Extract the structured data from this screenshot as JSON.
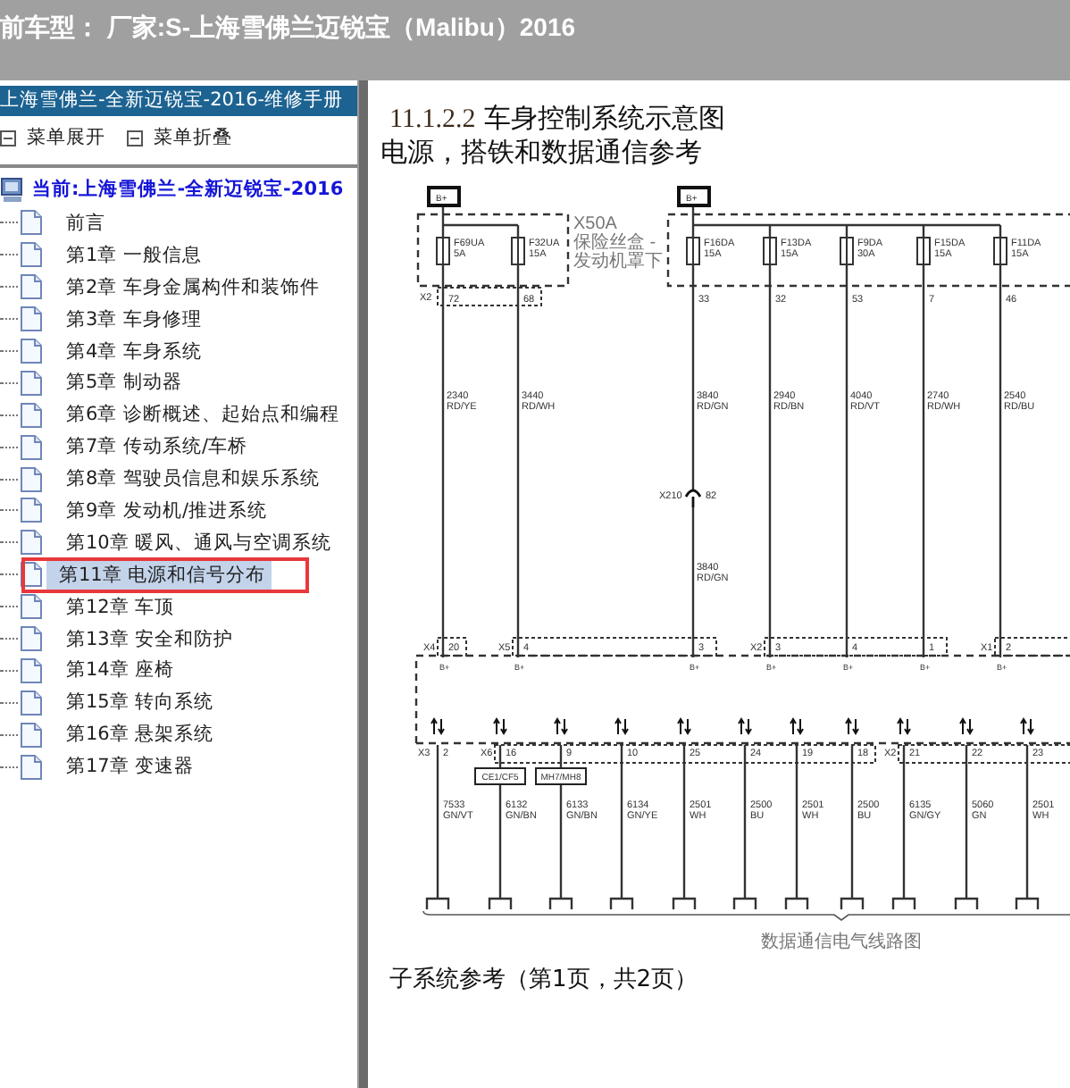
{
  "title_bar": {
    "text": "前车型：  厂家:S-上海雪佛兰迈锐宝（Malibu）2016"
  },
  "sidebar": {
    "header": "上海雪佛兰-全新迈锐宝-2016-维修手册",
    "toolbar": [
      {
        "label": "菜单展开"
      },
      {
        "label": "菜单折叠"
      }
    ],
    "tree": {
      "label": "当前:上海雪佛兰-全新迈锐宝-2016",
      "children": [
        {
          "label": "前言",
          "selected": false
        },
        {
          "label": "第1章 一般信息",
          "selected": false
        },
        {
          "label": "第2章 车身金属构件和装饰件",
          "selected": false
        },
        {
          "label": "第3章 车身修理",
          "selected": false
        },
        {
          "label": "第4章 车身系统",
          "selected": false
        },
        {
          "label": "第5章 制动器",
          "selected": false
        },
        {
          "label": "第6章 诊断概述、起始点和编程",
          "selected": false
        },
        {
          "label": "第7章 传动系统/车桥",
          "selected": false
        },
        {
          "label": "第8章 驾驶员信息和娱乐系统",
          "selected": false
        },
        {
          "label": "第9章 发动机/推进系统",
          "selected": false
        },
        {
          "label": "第10章 暖风、通风与空调系统",
          "selected": false
        },
        {
          "label": "第11章 电源和信号分布",
          "selected": true
        },
        {
          "label": "第12章 车顶",
          "selected": false
        },
        {
          "label": "第13章 安全和防护",
          "selected": false
        },
        {
          "label": "第14章 座椅",
          "selected": false
        },
        {
          "label": "第15章 转向系统",
          "selected": false
        },
        {
          "label": "第16章 悬架系统",
          "selected": false
        },
        {
          "label": "第17章 变速器",
          "selected": false
        }
      ]
    }
  },
  "document": {
    "heading_number": "11.1.2.2",
    "heading": "车身控制系统示意图",
    "subtitle": "电源，搭铁和数据通信参考",
    "diagram": {
      "fuse_groups": [
        {
          "source": "B+",
          "box_label": [
            "X50A",
            "保险丝盒 -",
            "发动机罩下"
          ],
          "connector": "X2",
          "fuses": [
            {
              "fuse": "F69UA",
              "rating": "5A",
              "pin": "72",
              "wire": "2340",
              "color_code": "RD/YE",
              "bottom_connector": "X4",
              "bottom_pin": "20",
              "terminal": "B+"
            },
            {
              "fuse": "F32UA",
              "rating": "15A",
              "pin": "68",
              "wire": "3440",
              "color_code": "RD/WH",
              "bottom_connector": "X5",
              "bottom_pin": "4",
              "terminal": "B+"
            }
          ]
        },
        {
          "source": "B+",
          "fuses": [
            {
              "fuse": "F16DA",
              "rating": "15A",
              "pin": "33",
              "wire": "3840",
              "color_code": "RD/GN",
              "inline": {
                "connector": "X210",
                "pin": "82",
                "wire": "3840",
                "color_code": "RD/GN"
              },
              "bottom_pin": "3",
              "terminal": "B+"
            },
            {
              "fuse": "F13DA",
              "rating": "15A",
              "pin": "32",
              "wire": "2940",
              "color_code": "RD/BN",
              "bottom_connector": "X2",
              "bottom_pin": "3",
              "terminal": "B+"
            },
            {
              "fuse": "F9DA",
              "rating": "30A",
              "pin": "53",
              "wire": "4040",
              "color_code": "RD/VT",
              "bottom_pin": "4",
              "terminal": "B+"
            },
            {
              "fuse": "F15DA",
              "rating": "15A",
              "pin": "7",
              "wire": "2740",
              "color_code": "RD/WH",
              "bottom_pin": "1",
              "terminal": "B+"
            },
            {
              "fuse": "F11DA",
              "rating": "15A",
              "pin": "46",
              "wire": "2540",
              "color_code": "RD/BU",
              "bottom_connector": "X1",
              "bottom_pin": "2",
              "terminal": "B+"
            }
          ]
        }
      ],
      "data_lines": [
        {
          "connector": "X3",
          "pin": "2",
          "wire": "7533",
          "color_code": "GN/VT"
        },
        {
          "connector": "X6",
          "pin": "16",
          "wire": "6132",
          "color_code": "GN/BN",
          "splice": "CE1/CF5"
        },
        {
          "pin": "9",
          "wire": "6133",
          "color_code": "GN/BN",
          "splice": "MH7/MH8"
        },
        {
          "pin": "10",
          "wire": "6134",
          "color_code": "GN/YE"
        },
        {
          "pin": "25",
          "wire": "2501",
          "color_code": "WH"
        },
        {
          "pin": "24",
          "wire": "2500",
          "color_code": "BU"
        },
        {
          "pin": "19",
          "wire": "2501",
          "color_code": "WH"
        },
        {
          "pin": "18",
          "wire": "2500",
          "color_code": "BU"
        },
        {
          "connector": "X2",
          "pin": "21",
          "wire": "6135",
          "color_code": "GN/GY"
        },
        {
          "pin": "22",
          "wire": "5060",
          "color_code": "GN"
        },
        {
          "pin": "23",
          "wire": "2501",
          "color_code": "WH"
        }
      ],
      "bus_label": "数据通信电气线路图"
    },
    "footer": "子系统参考（第1页，共2页）"
  }
}
